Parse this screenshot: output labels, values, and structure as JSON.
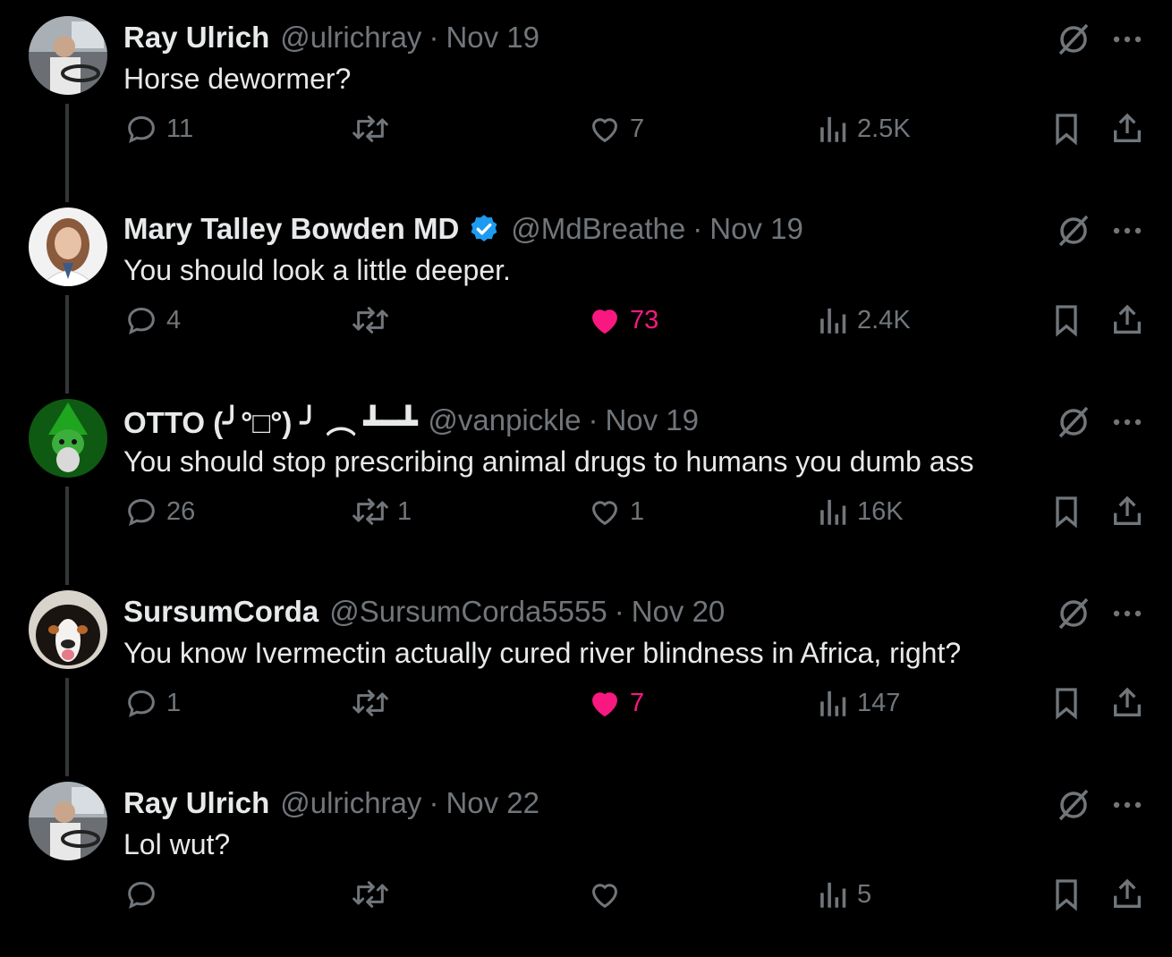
{
  "colors": {
    "background": "#000000",
    "text": "#e7e9ea",
    "muted": "#71767b",
    "like": "#f91880",
    "verified": "#1d9bf0",
    "thread_line": "#333639"
  },
  "tweets": [
    {
      "name": "Ray Ulrich",
      "handle": "@ulrichray",
      "separator": "·",
      "date": "Nov 19",
      "verified": false,
      "text": "Horse dewormer?",
      "replies": "11",
      "retweets": "",
      "likes": "7",
      "liked": false,
      "views": "2.5K",
      "avatar": "ray-avatar"
    },
    {
      "name": "Mary Talley Bowden MD",
      "handle": "@MdBreathe",
      "separator": "·",
      "date": "Nov 19",
      "verified": true,
      "text": "You should look a little deeper.",
      "replies": "4",
      "retweets": "",
      "likes": "73",
      "liked": true,
      "views": "2.4K",
      "avatar": "mary-avatar"
    },
    {
      "name": "OTTO (╯°□°) ╯ ︵ ┻━┻",
      "handle": "@vanpickle",
      "separator": "·",
      "date": "Nov 19",
      "verified": false,
      "text": "You should stop prescribing animal drugs to humans you dumb ass",
      "replies": "26",
      "retweets": "1",
      "likes": "1",
      "liked": false,
      "views": "16K",
      "avatar": "otto-avatar"
    },
    {
      "name": "SursumCorda",
      "handle": "@SursumCorda5555",
      "separator": "·",
      "date": "Nov 20",
      "verified": false,
      "text": "You know Ivermectin actually cured river blindness in Africa, right?",
      "replies": "1",
      "retweets": "",
      "likes": "7",
      "liked": true,
      "views": "147",
      "avatar": "dog-avatar"
    },
    {
      "name": "Ray Ulrich",
      "handle": "@ulrichray",
      "separator": "·",
      "date": "Nov 22",
      "verified": false,
      "text": "Lol wut?",
      "replies": "",
      "retweets": "",
      "likes": "",
      "liked": false,
      "views": "5",
      "avatar": "ray-avatar"
    }
  ]
}
